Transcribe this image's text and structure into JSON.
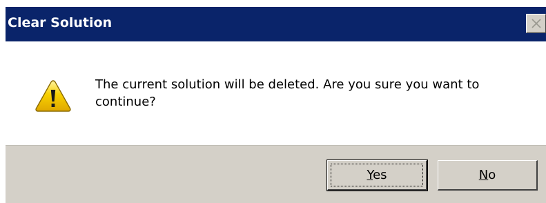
{
  "window": {
    "title": "Clear Solution",
    "close_icon": "close-icon",
    "title_bar_color": "#0a246a"
  },
  "dialog": {
    "icon": "warning-icon",
    "message": "The current solution will be deleted. Are you sure you want to continue?"
  },
  "buttons": {
    "yes": {
      "mnemonic": "Y",
      "rest": "es"
    },
    "no": {
      "mnemonic": "N",
      "rest": "o"
    }
  },
  "colors": {
    "face": "#d4d0c8",
    "warning_fill": "#f5c400"
  }
}
